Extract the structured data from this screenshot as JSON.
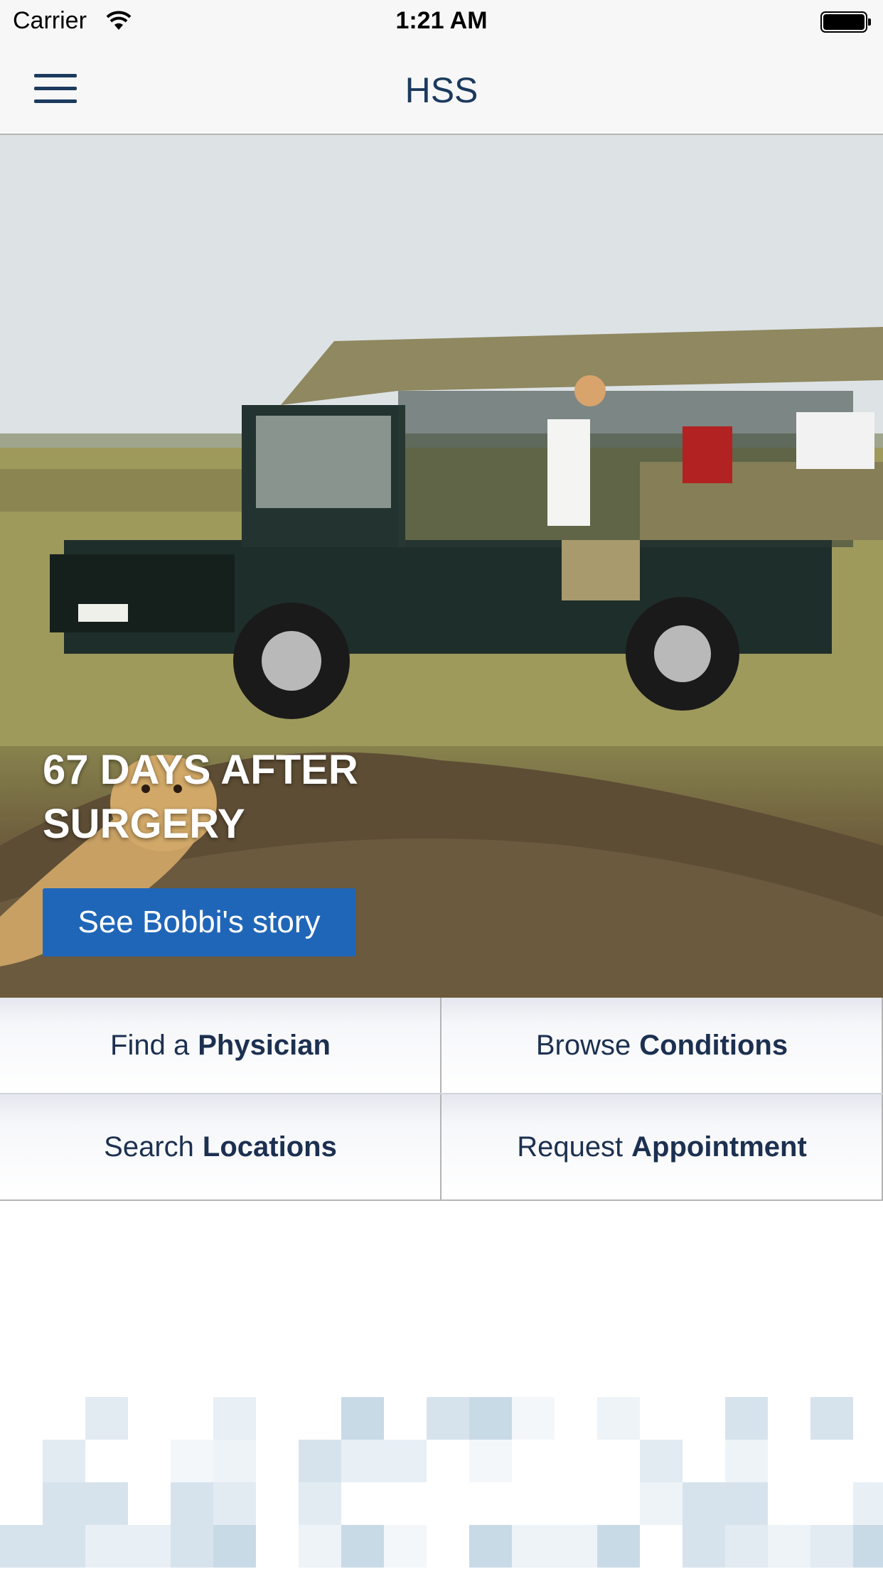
{
  "status_bar": {
    "carrier": "Carrier",
    "time": "1:21 AM"
  },
  "nav": {
    "title": "HSS",
    "menu_icon": "hamburger-menu-icon"
  },
  "hero": {
    "headline": "67 DAYS AFTER SURGERY",
    "button_label": "See Bobbi's story",
    "button_color": "#2066b8",
    "image_description_icon": "safari-photo"
  },
  "quick_links": [
    {
      "prefix": "Find a",
      "bold": "Physician"
    },
    {
      "prefix": "Browse",
      "bold": "Conditions"
    },
    {
      "prefix": "Search",
      "bold": "Locations"
    },
    {
      "prefix": "Request",
      "bold": "Appointment"
    }
  ],
  "colors": {
    "brand_navy": "#1c3a5e",
    "text": "#1c3050",
    "nav_bg": "#f7f7f7"
  }
}
